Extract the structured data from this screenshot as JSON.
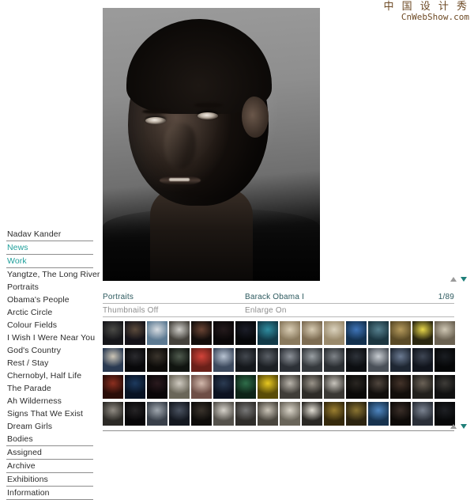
{
  "watermark": {
    "cn": "中 国 设 计 秀",
    "en": "CnWebShow.com",
    "color": "#6d4a25"
  },
  "sidebar": {
    "items": [
      {
        "label": "Nadav Kander",
        "style": "title"
      },
      {
        "label": "News",
        "style": "link"
      },
      {
        "label": "Work",
        "style": "link"
      },
      {
        "label": "Yangtze, The Long River",
        "style": "plain"
      },
      {
        "label": "Portraits",
        "style": "plain"
      },
      {
        "label": "Obama's People",
        "style": "plain"
      },
      {
        "label": "Arctic Circle",
        "style": "plain"
      },
      {
        "label": "Colour Fields",
        "style": "plain"
      },
      {
        "label": "I Wish I Were Near You",
        "style": "plain"
      },
      {
        "label": "God's Country",
        "style": "plain"
      },
      {
        "label": "Rest / Stay",
        "style": "plain"
      },
      {
        "label": "Chernobyl, Half Life",
        "style": "plain"
      },
      {
        "label": "The Parade",
        "style": "plain"
      },
      {
        "label": "Ah Wilderness",
        "style": "plain"
      },
      {
        "label": "Signs That We Exist",
        "style": "plain"
      },
      {
        "label": "Dream Girls",
        "style": "plain"
      },
      {
        "label": "Bodies",
        "style": "plain"
      },
      {
        "label": "Assigned",
        "style": "ruled"
      },
      {
        "label": "Archive",
        "style": "ruled"
      },
      {
        "label": "Exhibitions",
        "style": "ruled"
      },
      {
        "label": "Information",
        "style": "ruled"
      }
    ],
    "link_color": "#1f9f9b",
    "text_color": "#2b2b2b"
  },
  "main_image": {
    "alt": "Barack Obama black and white portrait",
    "background_color": "#8a8a8a"
  },
  "panel": {
    "gallery_name": "Portraits",
    "image_title": "Barack Obama I",
    "counter": "1/89",
    "thumbnails_toggle": "Thumbnails Off",
    "enlarge_toggle": "Enlarge On",
    "header_color": "#2d5a5f",
    "sub_color": "#8e8e8e"
  },
  "arrows": {
    "up": "scroll-up-arrow",
    "down": "scroll-down-arrow",
    "up_color": "#9a9a9a",
    "down_color": "#1f7f79"
  },
  "thumbnails": [
    {
      "id": 1,
      "c1": "#4a4a46",
      "c2": "#16161a"
    },
    {
      "id": 2,
      "c1": "#5c4b3c",
      "c2": "#141218"
    },
    {
      "id": 3,
      "c1": "#d8dde2",
      "c2": "#5d7a92"
    },
    {
      "id": 4,
      "c1": "#cfcec9",
      "c2": "#45423c"
    },
    {
      "id": 5,
      "c1": "#6a4434",
      "c2": "#120d0b"
    },
    {
      "id": 6,
      "c1": "#241a1c",
      "c2": "#0a0708"
    },
    {
      "id": 7,
      "c1": "#1b1d28",
      "c2": "#060709"
    },
    {
      "id": 8,
      "c1": "#2f8da0",
      "c2": "#123a48"
    },
    {
      "id": 9,
      "c1": "#d9cdb4",
      "c2": "#8a7a5e"
    },
    {
      "id": 10,
      "c1": "#d7cbb2",
      "c2": "#7d6c52"
    },
    {
      "id": 11,
      "c1": "#dad2bd",
      "c2": "#9a8a6c"
    },
    {
      "id": 12,
      "c1": "#3f74b8",
      "c2": "#13314f"
    },
    {
      "id": 13,
      "c1": "#56808e",
      "c2": "#1c3640"
    },
    {
      "id": 14,
      "c1": "#b59a5c",
      "c2": "#5a4a26"
    },
    {
      "id": 15,
      "c1": "#e8d84a",
      "c2": "#2b2710"
    },
    {
      "id": 16,
      "c1": "#cfc7b4",
      "c2": "#6b6252"
    },
    {
      "id": 17,
      "c1": "#cdc6b6",
      "c2": "#2a3a52"
    },
    {
      "id": 18,
      "c1": "#2a2a2e",
      "c2": "#08080a"
    },
    {
      "id": 19,
      "c1": "#3a342c",
      "c2": "#0d0b09"
    },
    {
      "id": 20,
      "c1": "#4f5b4e",
      "c2": "#101410"
    },
    {
      "id": 21,
      "c1": "#d3443a",
      "c2": "#6a2019"
    },
    {
      "id": 22,
      "c1": "#b8c3d2",
      "c2": "#3d4a5e"
    },
    {
      "id": 23,
      "c1": "#43484f",
      "c2": "#14171b"
    },
    {
      "id": 24,
      "c1": "#5a5f66",
      "c2": "#1c2024"
    },
    {
      "id": 25,
      "c1": "#8d9299",
      "c2": "#2c3036"
    },
    {
      "id": 26,
      "c1": "#9aa0a4",
      "c2": "#34383c"
    },
    {
      "id": 27,
      "c1": "#7e8388",
      "c2": "#2a2e32"
    },
    {
      "id": 28,
      "c1": "#2e333a",
      "c2": "#0c0e11"
    },
    {
      "id": 29,
      "c1": "#c8cdd2",
      "c2": "#4a5058"
    },
    {
      "id": 30,
      "c1": "#6b7a92",
      "c2": "#1e2632"
    },
    {
      "id": 31,
      "c1": "#3e4654",
      "c2": "#10141c"
    },
    {
      "id": 32,
      "c1": "#1a1d22",
      "c2": "#060708"
    },
    {
      "id": 33,
      "c1": "#8c2f20",
      "c2": "#2a0d08"
    },
    {
      "id": 34,
      "c1": "#1d3a5e",
      "c2": "#081223"
    },
    {
      "id": 35,
      "c1": "#2a1a1e",
      "c2": "#0a0608"
    },
    {
      "id": 36,
      "c1": "#cfcac0",
      "c2": "#6a6659"
    },
    {
      "id": 37,
      "c1": "#d2b8ac",
      "c2": "#6e4e46"
    },
    {
      "id": 38,
      "c1": "#2b3b52",
      "c2": "#0c1220"
    },
    {
      "id": 39,
      "c1": "#2f6d4a",
      "c2": "#0d2418"
    },
    {
      "id": 40,
      "c1": "#e8c820",
      "c2": "#5a4c08"
    },
    {
      "id": 41,
      "c1": "#b9b4ab",
      "c2": "#403d38"
    },
    {
      "id": 42,
      "c1": "#9a948a",
      "c2": "#2e2c28"
    },
    {
      "id": 43,
      "c1": "#c8c4bc",
      "c2": "#3a3834"
    },
    {
      "id": 44,
      "c1": "#2a2622",
      "c2": "#0a0908"
    },
    {
      "id": 45,
      "c1": "#50463e",
      "c2": "#120f0d"
    },
    {
      "id": 46,
      "c1": "#43332a",
      "c2": "#120d0a"
    },
    {
      "id": 47,
      "c1": "#6b6257",
      "c2": "#22201c"
    },
    {
      "id": 48,
      "c1": "#3e3c38",
      "c2": "#101010"
    },
    {
      "id": 49,
      "c1": "#8f8a82",
      "c2": "#2c2a26"
    },
    {
      "id": 50,
      "c1": "#262426",
      "c2": "#070608"
    },
    {
      "id": 51,
      "c1": "#9fa6ae",
      "c2": "#39404a"
    },
    {
      "id": 52,
      "c1": "#4a5260",
      "c2": "#141820"
    },
    {
      "id": 53,
      "c1": "#3a332c",
      "c2": "#0e0c0a"
    },
    {
      "id": 54,
      "c1": "#d6d2ca",
      "c2": "#55524c"
    },
    {
      "id": 55,
      "c1": "#9b9views",
      "c2": "#2f2d2a"
    },
    {
      "id": 56,
      "c1": "#cac4b8",
      "c2": "#4a463e"
    },
    {
      "id": 57,
      "c1": "#d9d4c8",
      "c2": "#6a655a"
    },
    {
      "id": 58,
      "c1": "#e2ded4",
      "c2": "#2a2824"
    },
    {
      "id": 59,
      "c1": "#9a7e30",
      "c2": "#362a0c"
    },
    {
      "id": 60,
      "c1": "#8a7432",
      "c2": "#2c2410"
    },
    {
      "id": 61,
      "c1": "#4f86c0",
      "c2": "#17334f"
    },
    {
      "id": 62,
      "c1": "#3a2e28",
      "c2": "#0d0a08"
    },
    {
      "id": 63,
      "c1": "#7a8290",
      "c2": "#2a2f38"
    },
    {
      "id": 64,
      "c1": "#1e2024",
      "c2": "#070809"
    }
  ]
}
